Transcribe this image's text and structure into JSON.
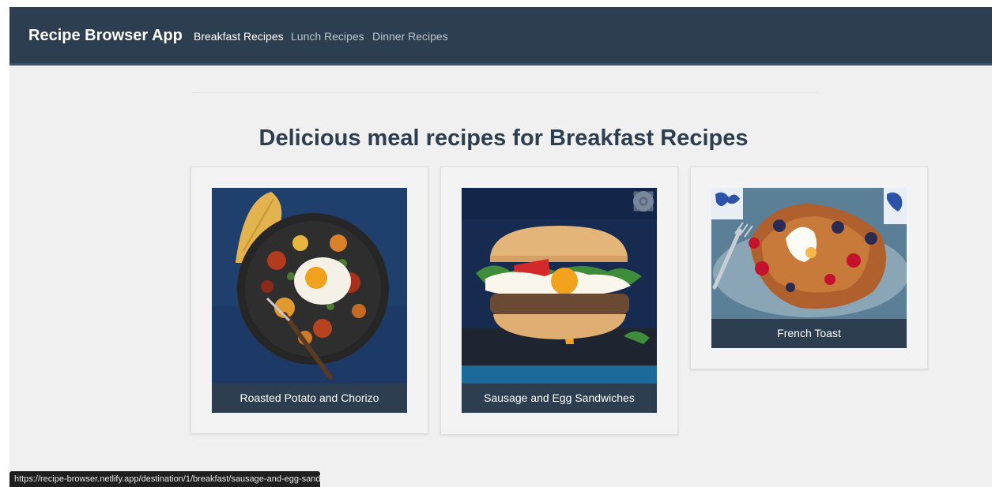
{
  "navbar": {
    "brand": "Recipe Browser App",
    "links": [
      {
        "label": "Breakfast Recipes",
        "active": true
      },
      {
        "label": "Lunch Recipes",
        "active": false
      },
      {
        "label": "Dinner Recipes",
        "active": false
      }
    ]
  },
  "main": {
    "heading": "Delicious meal recipes for Breakfast Recipes",
    "recipes": [
      {
        "name": "Roasted Potato and Chorizo"
      },
      {
        "name": "Sausage and Egg Sandwiches"
      },
      {
        "name": "French Toast"
      }
    ]
  },
  "status_bar": {
    "url": "https://recipe-browser.netlify.app/destination/1/breakfast/sausage-and-egg-sandwiches"
  },
  "colors": {
    "navbar_bg": "#2c3e50",
    "heading": "#2c3e50",
    "caption_bg": "#2c3e50",
    "page_bg": "#f0f0f0"
  },
  "icons": {
    "lens": "google-lens-icon"
  }
}
